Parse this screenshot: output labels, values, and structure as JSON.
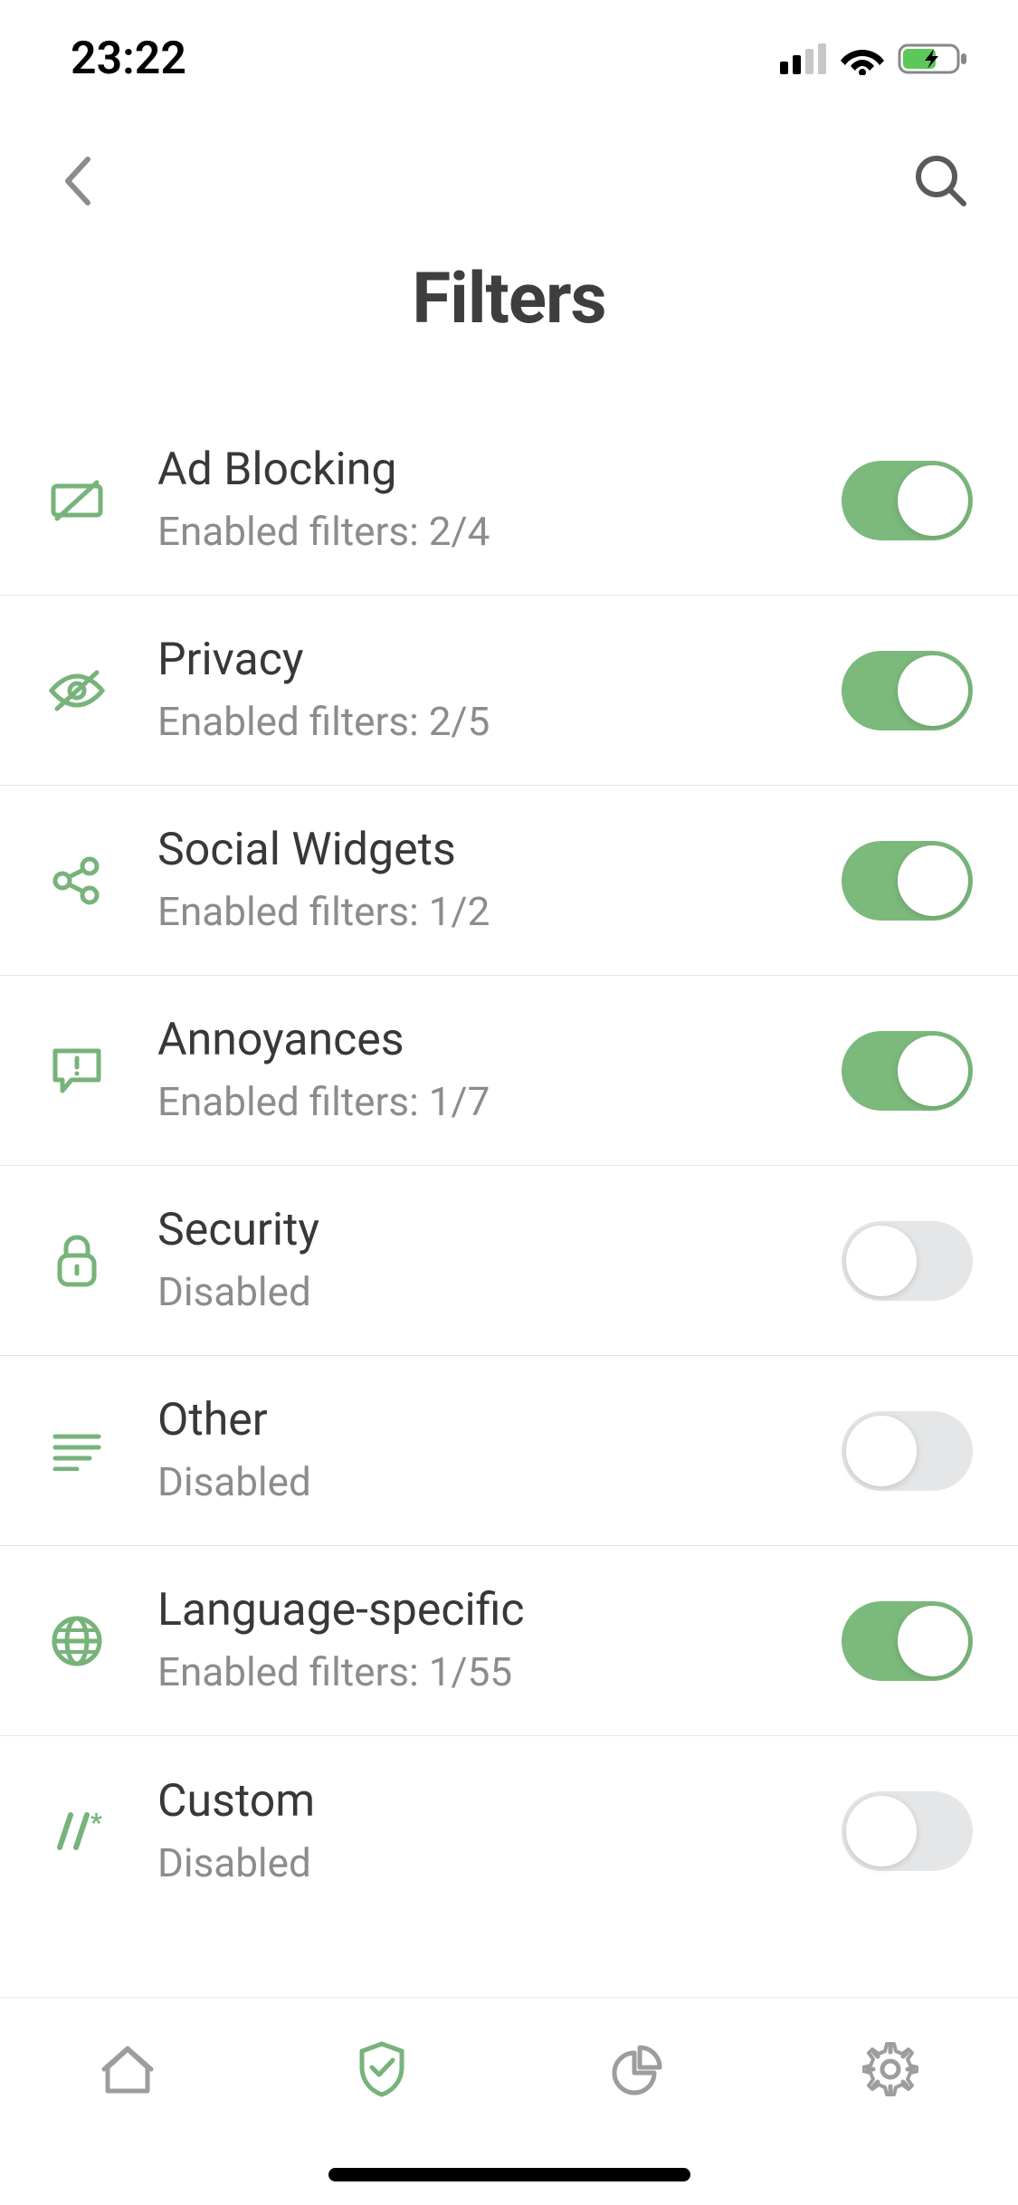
{
  "status": {
    "time": "23:22"
  },
  "header": {
    "title": "Filters"
  },
  "filters": [
    {
      "icon": "ad-block",
      "title": "Ad Blocking",
      "subtitle": "Enabled filters: 2/4",
      "enabled": true
    },
    {
      "icon": "privacy",
      "title": "Privacy",
      "subtitle": "Enabled filters: 2/5",
      "enabled": true
    },
    {
      "icon": "social",
      "title": "Social Widgets",
      "subtitle": "Enabled filters: 1/2",
      "enabled": true
    },
    {
      "icon": "annoyance",
      "title": "Annoyances",
      "subtitle": "Enabled filters: 1/7",
      "enabled": true
    },
    {
      "icon": "security",
      "title": "Security",
      "subtitle": "Disabled",
      "enabled": false
    },
    {
      "icon": "other",
      "title": "Other",
      "subtitle": "Disabled",
      "enabled": false
    },
    {
      "icon": "language",
      "title": "Language-specific",
      "subtitle": "Enabled filters: 1/55",
      "enabled": true
    },
    {
      "icon": "custom",
      "title": "Custom",
      "subtitle": "Disabled",
      "enabled": false
    }
  ],
  "colors": {
    "accent": "#7cb97c",
    "iconGreen": "#77b37a"
  }
}
